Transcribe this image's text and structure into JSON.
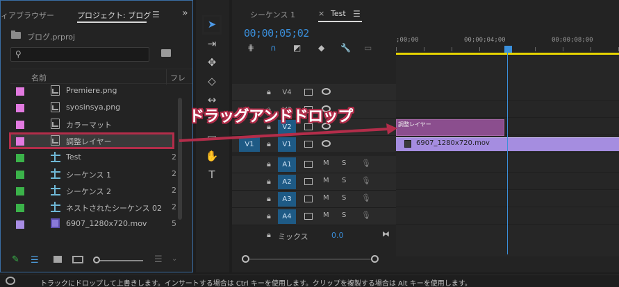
{
  "project_panel": {
    "tab_media": "ィアブラウザー",
    "tab_project": "プロジェクト: ブログ",
    "file_name": "ブログ.prproj",
    "search_placeholder": "",
    "col_name": "名前",
    "col_frame": "フレ",
    "items": [
      {
        "label": "Premiere.png",
        "swatch": "#e27ae0",
        "icon": "image-icon",
        "extra": ""
      },
      {
        "label": "syosinsya.png",
        "swatch": "#e27ae0",
        "icon": "image-icon",
        "extra": ""
      },
      {
        "label": "カラーマット",
        "swatch": "#e27ae0",
        "icon": "image-icon",
        "extra": ""
      },
      {
        "label": "調整レイヤー",
        "swatch": "#e27ae0",
        "icon": "image-icon",
        "extra": ""
      },
      {
        "label": "Test",
        "swatch": "#3bb34a",
        "icon": "sequence-icon",
        "extra": "2"
      },
      {
        "label": "シーケンス 1",
        "swatch": "#3bb34a",
        "icon": "sequence-icon",
        "extra": "2"
      },
      {
        "label": "シーケンス 2",
        "swatch": "#3bb34a",
        "icon": "sequence-icon",
        "extra": "2"
      },
      {
        "label": "ネストされたシーケンス 02",
        "swatch": "#3bb34a",
        "icon": "sequence-icon",
        "extra": "2"
      },
      {
        "label": "6907_1280x720.mov",
        "swatch": "#a88de4",
        "icon": "video-icon",
        "extra": "5"
      }
    ]
  },
  "tools": {
    "type_tool_glyph": "T"
  },
  "timeline": {
    "tab_seq1": "シーケンス 1",
    "tab_close": "×",
    "tab_test": "Test",
    "timecode": "00;00;05;02",
    "ruler_labels": [
      ";00;00",
      "00;00;04;00",
      "00;00;08;00"
    ],
    "video_tracks": [
      {
        "name": "V4",
        "src": ""
      },
      {
        "name": "V3",
        "src": ""
      },
      {
        "name": "V2",
        "src": ""
      },
      {
        "name": "V1",
        "src": "V1"
      }
    ],
    "audio_tracks": [
      {
        "name": "A1",
        "src": ""
      },
      {
        "name": "A2",
        "src": ""
      },
      {
        "name": "A3",
        "src": ""
      },
      {
        "name": "A4",
        "src": ""
      }
    ],
    "mute_label": "M",
    "solo_label": "S",
    "mix_label": "ミックス",
    "mix_value": "0.0",
    "clip_v2": "調整レイヤー",
    "clip_v1": "6907_1280x720.mov"
  },
  "annotation": {
    "text": "ドラッグアンドドロップ",
    "color": "#b32d4a"
  },
  "status": {
    "text": "トラックにドロップして上書きします。インサートする場合は Ctrl キーを使用します。クリップを複製する場合は Alt キーを使用します。"
  }
}
